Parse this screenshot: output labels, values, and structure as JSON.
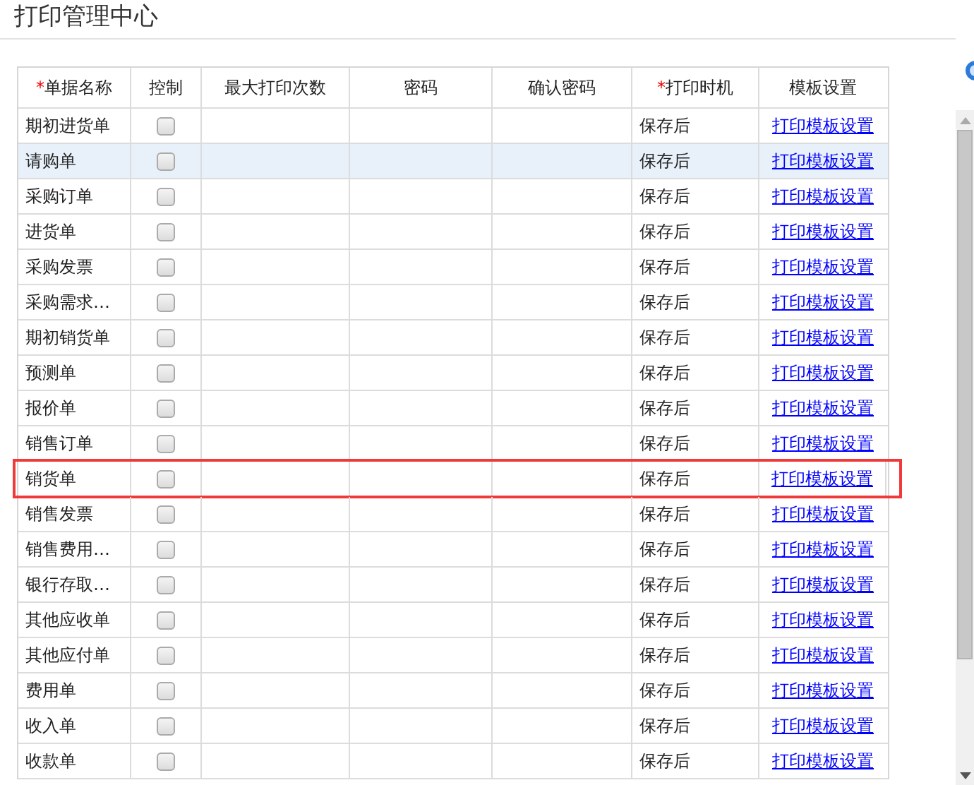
{
  "title": "打印管理中心",
  "table": {
    "columns": [
      {
        "label": "单据名称",
        "required": true
      },
      {
        "label": "控制",
        "required": false
      },
      {
        "label": "最大打印次数",
        "required": false
      },
      {
        "label": "密码",
        "required": false
      },
      {
        "label": "确认密码",
        "required": false
      },
      {
        "label": "打印时机",
        "required": true
      },
      {
        "label": "模板设置",
        "required": false
      }
    ],
    "required_mark": "*",
    "rows": [
      {
        "name": "期初进货单",
        "checked": false,
        "timing": "保存后",
        "link": "打印模板设置",
        "selected": false,
        "annotated": false
      },
      {
        "name": "请购单",
        "checked": false,
        "timing": "保存后",
        "link": "打印模板设置",
        "selected": true,
        "annotated": false
      },
      {
        "name": "采购订单",
        "checked": false,
        "timing": "保存后",
        "link": "打印模板设置",
        "selected": false,
        "annotated": false
      },
      {
        "name": "进货单",
        "checked": false,
        "timing": "保存后",
        "link": "打印模板设置",
        "selected": false,
        "annotated": false
      },
      {
        "name": "采购发票",
        "checked": false,
        "timing": "保存后",
        "link": "打印模板设置",
        "selected": false,
        "annotated": false
      },
      {
        "name": "采购需求…",
        "checked": false,
        "timing": "保存后",
        "link": "打印模板设置",
        "selected": false,
        "annotated": false
      },
      {
        "name": "期初销货单",
        "checked": false,
        "timing": "保存后",
        "link": "打印模板设置",
        "selected": false,
        "annotated": false
      },
      {
        "name": "预测单",
        "checked": false,
        "timing": "保存后",
        "link": "打印模板设置",
        "selected": false,
        "annotated": false
      },
      {
        "name": "报价单",
        "checked": false,
        "timing": "保存后",
        "link": "打印模板设置",
        "selected": false,
        "annotated": false
      },
      {
        "name": "销售订单",
        "checked": false,
        "timing": "保存后",
        "link": "打印模板设置",
        "selected": false,
        "annotated": false
      },
      {
        "name": "销货单",
        "checked": false,
        "timing": "保存后",
        "link": "打印模板设置",
        "selected": false,
        "annotated": true
      },
      {
        "name": "销售发票",
        "checked": false,
        "timing": "保存后",
        "link": "打印模板设置",
        "selected": false,
        "annotated": false
      },
      {
        "name": "销售费用…",
        "checked": false,
        "timing": "保存后",
        "link": "打印模板设置",
        "selected": false,
        "annotated": false
      },
      {
        "name": "银行存取…",
        "checked": false,
        "timing": "保存后",
        "link": "打印模板设置",
        "selected": false,
        "annotated": false
      },
      {
        "name": "其他应收单",
        "checked": false,
        "timing": "保存后",
        "link": "打印模板设置",
        "selected": false,
        "annotated": false
      },
      {
        "name": "其他应付单",
        "checked": false,
        "timing": "保存后",
        "link": "打印模板设置",
        "selected": false,
        "annotated": false
      },
      {
        "name": "费用单",
        "checked": false,
        "timing": "保存后",
        "link": "打印模板设置",
        "selected": false,
        "annotated": false
      },
      {
        "name": "收入单",
        "checked": false,
        "timing": "保存后",
        "link": "打印模板设置",
        "selected": false,
        "annotated": false
      },
      {
        "name": "收款单",
        "checked": false,
        "timing": "保存后",
        "link": "打印模板设置",
        "selected": false,
        "annotated": false
      }
    ]
  }
}
